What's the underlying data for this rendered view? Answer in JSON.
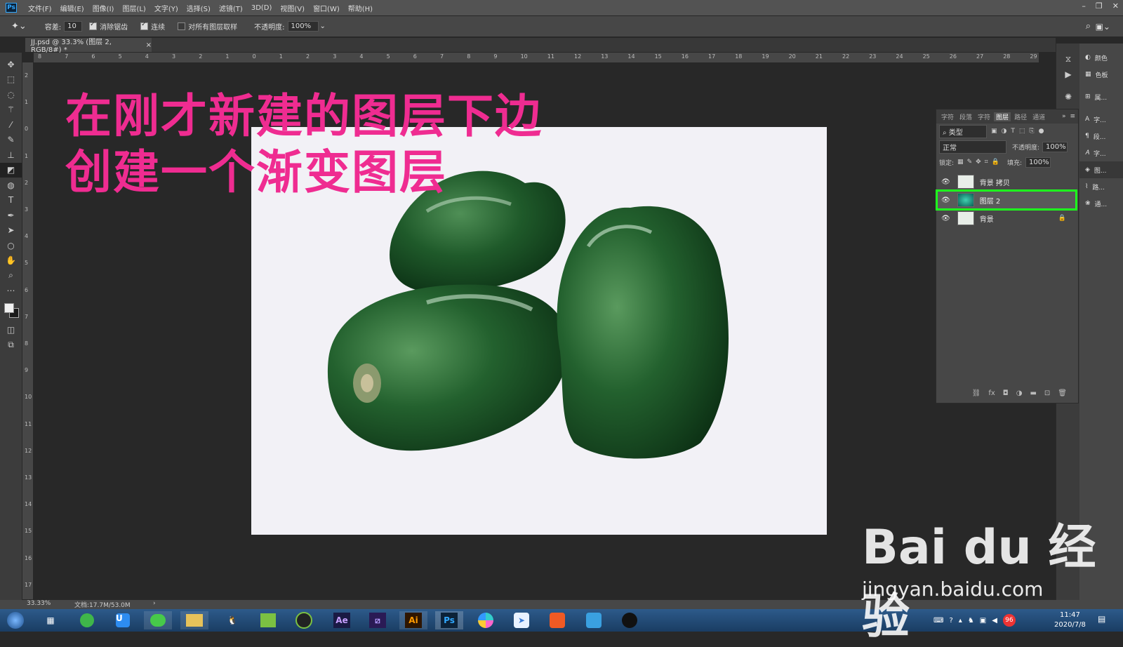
{
  "menubar": {
    "logo": "Ps",
    "items": [
      "文件(F)",
      "编辑(E)",
      "图像(I)",
      "图层(L)",
      "文字(Y)",
      "选择(S)",
      "滤镜(T)",
      "3D(D)",
      "视图(V)",
      "窗口(W)",
      "帮助(H)"
    ],
    "window_controls": [
      "–",
      "❐",
      "✕"
    ]
  },
  "options": {
    "tolerance_label": "容差:",
    "tolerance_value": "10",
    "antialias_label": "消除锯齿",
    "contiguous_label": "连续",
    "sample_all_label": "对所有图层取样",
    "opacity_label": "不透明度:",
    "opacity_value": "100%"
  },
  "document": {
    "tab_title": "JJ.psd @ 33.3% (图层 2, RGB/8#) *",
    "close": "×"
  },
  "ruler": {
    "top": [
      "8",
      "7",
      "6",
      "5",
      "4",
      "3",
      "2",
      "1",
      "0",
      "1",
      "2",
      "3",
      "4",
      "5",
      "6",
      "7",
      "8",
      "9",
      "10",
      "11",
      "12",
      "13",
      "14",
      "15",
      "16",
      "17",
      "18",
      "19",
      "20",
      "21",
      "22",
      "23",
      "24",
      "25",
      "26",
      "27",
      "28",
      "29"
    ],
    "left": [
      "2",
      "1",
      "0",
      "1",
      "2",
      "3",
      "4",
      "5",
      "6",
      "7",
      "8",
      "9",
      "10",
      "11",
      "12",
      "13",
      "14",
      "15",
      "16",
      "17"
    ]
  },
  "overlay": {
    "line1": "在刚才新建的图层下边",
    "line2": "创建一个渐变图层"
  },
  "dock": {
    "items": [
      "颜色",
      "色板",
      "属...",
      "字...",
      "段...",
      "字...",
      "图...",
      "路...",
      "通..."
    ]
  },
  "layers_panel": {
    "tabs": [
      "字符",
      "段落",
      "字符",
      "图层",
      "路径",
      "通道"
    ],
    "active_tab": "图层",
    "filter_label": "类型",
    "blend_mode": "正常",
    "opacity_label": "不透明度:",
    "opacity_value": "100%",
    "lock_label": "锁定:",
    "fill_label": "填充:",
    "fill_value": "100%",
    "layers": [
      {
        "name": "背景 拷贝",
        "selected": false,
        "locked": false
      },
      {
        "name": "图层 2",
        "selected": true,
        "locked": false
      },
      {
        "name": "背景",
        "selected": false,
        "locked": true
      }
    ],
    "footer_icons": [
      "link-icon",
      "fx-icon",
      "mask-icon",
      "adjustment-icon",
      "folder-icon",
      "new-layer-icon",
      "trash-icon"
    ],
    "highlight_color": "#1dff1d"
  },
  "status": {
    "zoom": "33.33%",
    "doc_info": "文档:17.7M/53.0M"
  },
  "taskbar": {
    "apps": [
      "Ae",
      "Ai",
      "Ps"
    ],
    "clock_time": "11:47",
    "clock_date": "2020/7/8",
    "badge": "96"
  },
  "watermark": {
    "logo": "Bai du 经验",
    "url": "jingyan.baidu.com"
  }
}
